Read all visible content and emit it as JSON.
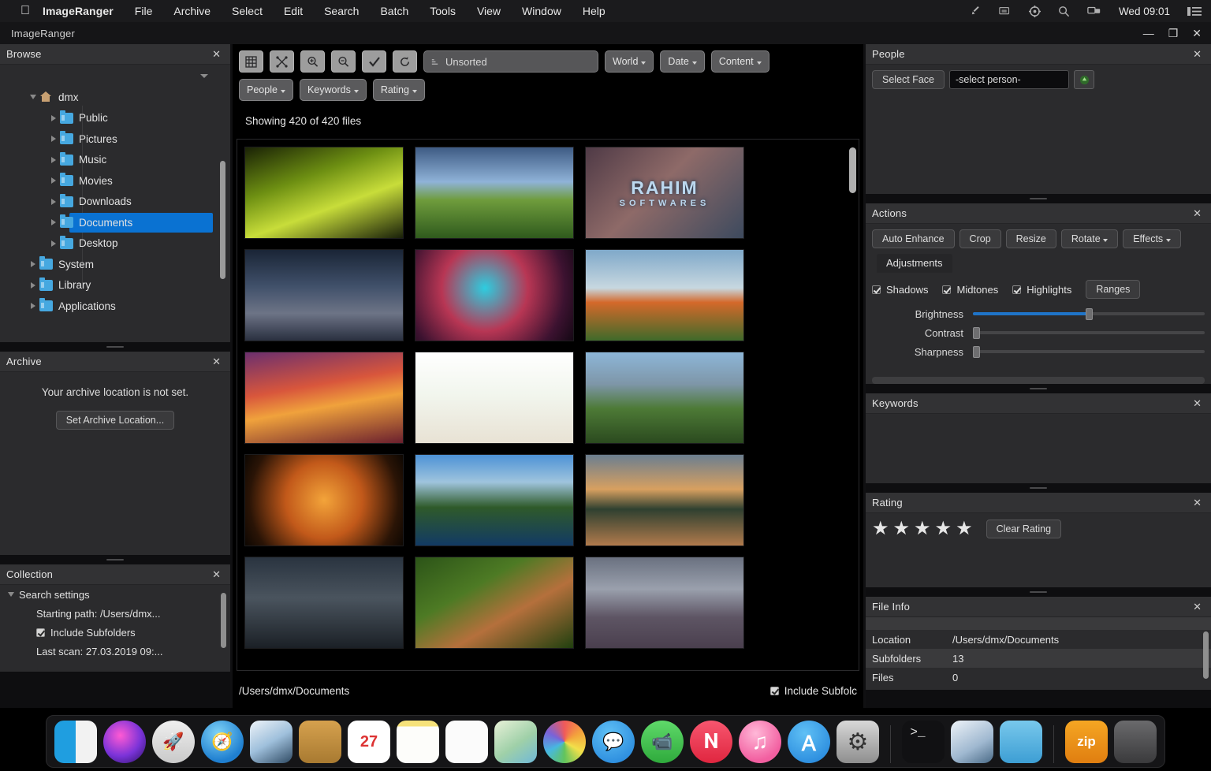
{
  "menubar": {
    "apple_icon": "apple-icon",
    "app_name": "ImageRanger",
    "items": [
      "File",
      "Archive",
      "Select",
      "Edit",
      "Search",
      "Batch",
      "Tools",
      "View",
      "Window",
      "Help"
    ],
    "status_icons": [
      "vpn-key-icon",
      "screen-share-icon",
      "gear-icon",
      "search-icon",
      "display-icon",
      "list-icon"
    ],
    "clock": "Wed 09:01"
  },
  "window": {
    "title": "ImageRanger",
    "minimize": "—",
    "maximize": "❐",
    "close": "✕"
  },
  "browse": {
    "title": "Browse",
    "close": "✕",
    "tree": [
      {
        "label": "dmx",
        "indent": 0,
        "arrow": "down",
        "icon": "home-icon",
        "selected": false
      },
      {
        "label": "Public",
        "indent": 1,
        "arrow": "right",
        "icon": "folder-icon",
        "selected": false
      },
      {
        "label": "Pictures",
        "indent": 1,
        "arrow": "right",
        "icon": "folder-icon",
        "selected": false
      },
      {
        "label": "Music",
        "indent": 1,
        "arrow": "right",
        "icon": "folder-icon",
        "selected": false
      },
      {
        "label": "Movies",
        "indent": 1,
        "arrow": "right",
        "icon": "folder-icon",
        "selected": false
      },
      {
        "label": "Downloads",
        "indent": 1,
        "arrow": "right",
        "icon": "folder-icon",
        "selected": false
      },
      {
        "label": "Documents",
        "indent": 1,
        "arrow": "right",
        "icon": "folder-icon",
        "selected": true
      },
      {
        "label": "Desktop",
        "indent": 1,
        "arrow": "right",
        "icon": "folder-icon",
        "selected": false
      },
      {
        "label": "System",
        "indent": 0,
        "arrow": "right",
        "icon": "folder-icon",
        "selected": false
      },
      {
        "label": "Library",
        "indent": 0,
        "arrow": "right",
        "icon": "folder-icon",
        "selected": false
      },
      {
        "label": "Applications",
        "indent": 0,
        "arrow": "right",
        "icon": "folder-icon",
        "selected": false
      }
    ]
  },
  "archive": {
    "title": "Archive",
    "close": "✕",
    "message": "Your archive location is not set.",
    "button": "Set Archive Location..."
  },
  "collection": {
    "title": "Collection",
    "close": "✕",
    "root": "Search settings",
    "starting_path": "Starting path: /Users/dmx...",
    "include_subfolders": "Include Subfolders",
    "last_scan": "Last scan: 27.03.2019 09:..."
  },
  "toolbar": {
    "icon_buttons": [
      "grid-view-icon",
      "fit-screen-icon",
      "zoom-in-icon",
      "zoom-out-icon",
      "select-all-icon",
      "refresh-icon"
    ],
    "search_placeholder": "Unsorted",
    "search_value": "Unsorted",
    "search_icon": "sort-icon",
    "filters": [
      "World",
      "Date",
      "Content"
    ],
    "filters2": [
      "People",
      "Keywords",
      "Rating"
    ],
    "showing": "Showing 420 of 420 files"
  },
  "gallery": {
    "thumbnails": [
      {
        "name": "green-leaves",
        "style": "linear-gradient(160deg,#1a2206 0%,#6d8f12 35%,#c8dd3a 62%,#19200a 100%)"
      },
      {
        "name": "lone-tree-field",
        "style": "linear-gradient(180deg,#3e5b84 0%,#8fb3d8 38%,#6f9c3c 58%,#2f5a1d 100%)"
      },
      {
        "name": "rahim-softwares-watermark",
        "style": "linear-gradient(135deg,#4f3a46 0%,#8e6a68 45%,#3d4a5e 100%)",
        "watermark": true
      },
      {
        "name": "dark-road-ruins",
        "style": "linear-gradient(180deg,#1a2536 0%,#40506a 40%,#6d7486 70%,#2a3040 100%)"
      },
      {
        "name": "blue-clown-art",
        "style": "radial-gradient(circle at 44% 42%, #2dcde0 0%, #b83654 42%, #3c1230 78%, #140814 100%)"
      },
      {
        "name": "autumn-tree",
        "style": "linear-gradient(180deg,#7fa8c9 0%,#c7d8e0 42%,#d4692a 58%,#3f6a2a 100%)"
      },
      {
        "name": "sunset-surfer",
        "style": "linear-gradient(170deg,#6b2f6e 0%,#d8563c 38%,#f0a23c 58%,#6a1f2e 100%)"
      },
      {
        "name": "vegetable-juices",
        "style": "linear-gradient(180deg,#ffffff 0%,#f2f6ee 45%,#e8e2d4 100%)"
      },
      {
        "name": "mountain-meadow",
        "style": "linear-gradient(180deg,#8db6d8 0%,#7e96a8 35%,#4d7a36 62%,#2b4a1f 100%)"
      },
      {
        "name": "orange-motorcycle",
        "style": "radial-gradient(circle at 50% 50%, #f3a43a 0%, #c2591a 42%, #2a1406 82%, #0d0702 100%)"
      },
      {
        "name": "alpine-lake",
        "style": "linear-gradient(180deg,#4d92d6 0%,#9fc4dd 30%,#2f5a2a 58%,#123a64 100%)"
      },
      {
        "name": "sunset-lake-reflection",
        "style": "linear-gradient(180deg,#6b7e90 0%,#d8a060 38%,#2f4030 60%,#b07a4c 100%)"
      },
      {
        "name": "dark-warehouse",
        "style": "linear-gradient(180deg,#2a3440 0%,#4a545e 45%,#1b2026 100%)"
      },
      {
        "name": "dog-in-grass",
        "style": "linear-gradient(150deg,#2c5418 0%,#4d7a24 35%,#b5703c 62%,#20400f 100%)"
      },
      {
        "name": "misty-lake-dusk",
        "style": "linear-gradient(180deg,#6a7180 0%,#9aa0ad 35%,#5e5564 66%,#4a3f4e 100%)"
      }
    ],
    "status_path": "/Users/dmx/Documents",
    "include_subfolders": "Include Subfolc"
  },
  "people": {
    "title": "People",
    "close": "✕",
    "select_face": "Select Face",
    "person_value": "-select person-",
    "add_icon": "add-person-icon"
  },
  "actions": {
    "title": "Actions",
    "close": "✕",
    "buttons": [
      "Auto Enhance",
      "Crop",
      "Resize",
      "Rotate",
      "Effects"
    ],
    "tab": "Adjustments",
    "checkboxes": [
      {
        "label": "Shadows",
        "checked": true
      },
      {
        "label": "Midtones",
        "checked": true
      },
      {
        "label": "Highlights",
        "checked": true
      }
    ],
    "ranges_button": "Ranges",
    "sliders": [
      {
        "label": "Brightness",
        "value": 50,
        "filled": true
      },
      {
        "label": "Contrast",
        "value": 0,
        "filled": false
      },
      {
        "label": "Sharpness",
        "value": 0,
        "filled": false
      }
    ]
  },
  "keywords": {
    "title": "Keywords",
    "close": "✕"
  },
  "rating": {
    "title": "Rating",
    "close": "✕",
    "star_count": 5,
    "star_glyph": "★",
    "clear_button": "Clear Rating"
  },
  "fileinfo": {
    "title": "File Info",
    "close": "✕",
    "rows": [
      {
        "key": "Location",
        "value": "/Users/dmx/Documents"
      },
      {
        "key": "Subfolders",
        "value": "13"
      },
      {
        "key": "Files",
        "value": "0"
      }
    ]
  },
  "dock": {
    "items": [
      {
        "name": "finder-icon",
        "glyph": "",
        "style": "background:linear-gradient(90deg,#1f9ee0 0%,#1f9ee0 50%,#f2f2f2 50%,#f2f2f2 100%)"
      },
      {
        "name": "siri-icon",
        "glyph": "",
        "round": true,
        "style": "background:radial-gradient(circle at 40% 35%,#ff5ad4,#7a33d8 55%,#2a1060)"
      },
      {
        "name": "launchpad-icon",
        "glyph": "🚀",
        "round": true,
        "style": "background:linear-gradient(180deg,#efefef,#c9c9c9)"
      },
      {
        "name": "safari-icon",
        "glyph": "🧭",
        "round": true,
        "style": "background:radial-gradient(circle at 40% 30%,#7fd3f7,#1f7fd0 70%)"
      },
      {
        "name": "photos-preview-icon",
        "glyph": "",
        "style": "background:linear-gradient(150deg,#eef3f8,#9fc0dc 50%,#2f4a63)"
      },
      {
        "name": "contacts-icon",
        "glyph": "",
        "style": "background:linear-gradient(180deg,#d6a14e,#a87a31)"
      },
      {
        "name": "calendar-icon",
        "glyph": "27",
        "style": "background:#ffffff"
      },
      {
        "name": "notes-icon",
        "glyph": "",
        "style": "background:linear-gradient(180deg,#f6e27a 0%,#f6e27a 14%,#fdfdfa 14%)"
      },
      {
        "name": "reminders-icon",
        "glyph": "",
        "style": "background:#fbfbfb"
      },
      {
        "name": "maps-icon",
        "glyph": "",
        "style": "background:linear-gradient(145deg,#e8f1d8,#9fd0a8 55%,#6fb8d8)"
      },
      {
        "name": "photos-icon",
        "glyph": "",
        "round": true,
        "style": "background:conic-gradient(#f05a5a,#f3a33c,#f2e04a,#62c45c,#47b8e0,#7a62d8,#f05a5a)"
      },
      {
        "name": "messages-icon",
        "glyph": "💬",
        "round": true,
        "style": "background:radial-gradient(circle at 40% 30%,#5fc0f5,#1e7fd8)"
      },
      {
        "name": "facetime-icon",
        "glyph": "📹",
        "round": true,
        "style": "background:linear-gradient(180deg,#5fd96a,#2faa3c)"
      },
      {
        "name": "news-icon",
        "glyph": "𝐍",
        "round": true,
        "style": "background:linear-gradient(180deg,#f7566f,#e0263f)"
      },
      {
        "name": "itunes-icon",
        "glyph": "♫",
        "round": true,
        "style": "background:radial-gradient(circle at 40% 30%,#ffb8d8,#f25fa0 70%)"
      },
      {
        "name": "app-store-icon",
        "glyph": "Ａ",
        "round": true,
        "style": "background:radial-gradient(circle at 40% 30%,#5fc0f5,#1e7fd8)"
      },
      {
        "name": "system-preferences-icon",
        "glyph": "⚙",
        "style": "background:linear-gradient(180deg,#d8d8d8,#8e8e8e)"
      },
      {
        "name": "terminal-icon",
        "glyph": ">_",
        "style": "background:#111113",
        "dot": true
      },
      {
        "name": "preview-icon",
        "glyph": "",
        "style": "background:linear-gradient(150deg,#eef3f8,#9fb8d0 60%,#4a6a86)"
      },
      {
        "name": "documents-folder-icon",
        "glyph": "",
        "style": "background:linear-gradient(180deg,#78c8ec,#3d9ed4)",
        "dot": true
      },
      {
        "name": "zip-archive-icon",
        "glyph": "zip",
        "style": "background:linear-gradient(180deg,#f5a623,#e07e10)"
      },
      {
        "name": "trash-icon",
        "glyph": "",
        "style": "background:linear-gradient(180deg,#6a6a6c,#3a3a3c)"
      }
    ]
  }
}
